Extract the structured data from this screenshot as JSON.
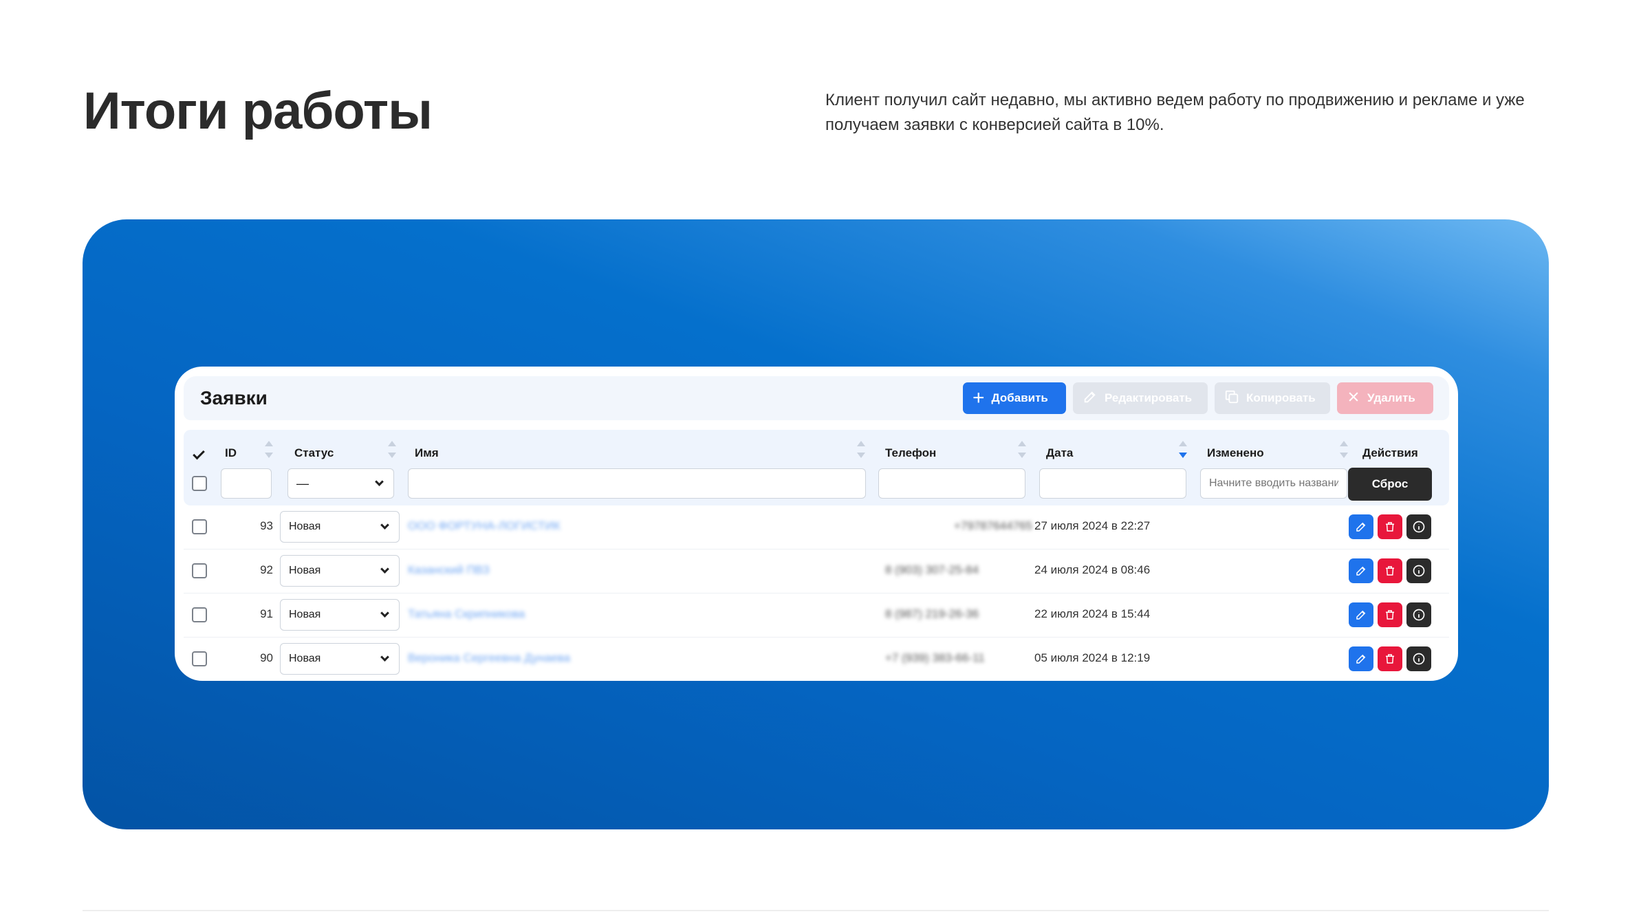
{
  "page": {
    "title": "Итоги работы",
    "description": "Клиент получил сайт недавно, мы активно ведем работу по продвижению и рекламе и уже получаем заявки с конверсией сайта  в 10%."
  },
  "panel": {
    "title": "Заявки",
    "toolbar": {
      "add_label": "Добавить",
      "edit_label": "Редактировать",
      "copy_label": "Копировать",
      "delete_label": "Удалить"
    }
  },
  "table": {
    "columns": {
      "id": "ID",
      "status": "Статус",
      "name": "Имя",
      "phone": "Телефон",
      "date": "Дата",
      "modified": "Изменено",
      "actions": "Действия"
    },
    "filters": {
      "status_value": "—",
      "modified_placeholder": "Начните вводить название",
      "reset_label": "Сброс"
    },
    "sorted_column": "date",
    "rows": [
      {
        "id": "93",
        "status": "Новая",
        "name": "ООО ФОРТУНА-ЛОГИСТИК",
        "phone": "+79787644765",
        "date": "27 июля 2024 в 22:27"
      },
      {
        "id": "92",
        "status": "Новая",
        "name": "Казанский ПВЗ",
        "phone": "8 (903) 307-25-84",
        "date": "24 июля 2024 в 08:46"
      },
      {
        "id": "91",
        "status": "Новая",
        "name": "Татьяна Скрипникова",
        "phone": "8 (987) 219-26-36",
        "date": "22 июля 2024 в 15:44"
      },
      {
        "id": "90",
        "status": "Новая",
        "name": "Вероника Сергеевна Дунаева",
        "phone": "+7 (939) 383-66-11",
        "date": "05 июля 2024 в 12:19"
      }
    ]
  },
  "colors": {
    "accent": "#1f73ec",
    "danger": "#e8173b",
    "dark": "#2b2b2b",
    "hero_gradient_start": "#6db8f2",
    "hero_gradient_end": "#0353a5"
  }
}
